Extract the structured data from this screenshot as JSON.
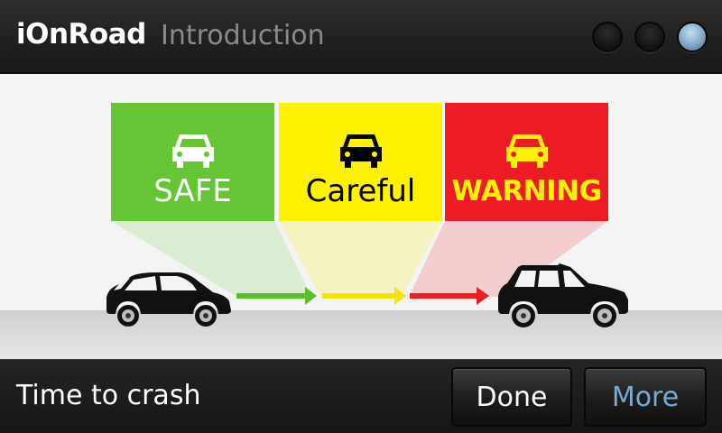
{
  "header": {
    "app_name": "iOnRoad",
    "page_title": "Introduction",
    "page_indicator": {
      "count": 3,
      "active_index": 3
    }
  },
  "zones": [
    {
      "label": "SAFE",
      "color": "#66c536",
      "icon": "car-icon"
    },
    {
      "label": "Careful",
      "color": "#fff200",
      "icon": "car-icon"
    },
    {
      "label": "WARNING",
      "color": "#ed1c24",
      "icon": "car-icon"
    }
  ],
  "illustration": {
    "own_vehicle": "hatchback-car-icon",
    "lead_vehicle": "suv-icon",
    "arrow_colors": [
      "#5cbf2a",
      "#f2e600",
      "#ed1c24"
    ]
  },
  "footer": {
    "text": "Time to crash",
    "done_label": "Done",
    "more_label": "More"
  }
}
